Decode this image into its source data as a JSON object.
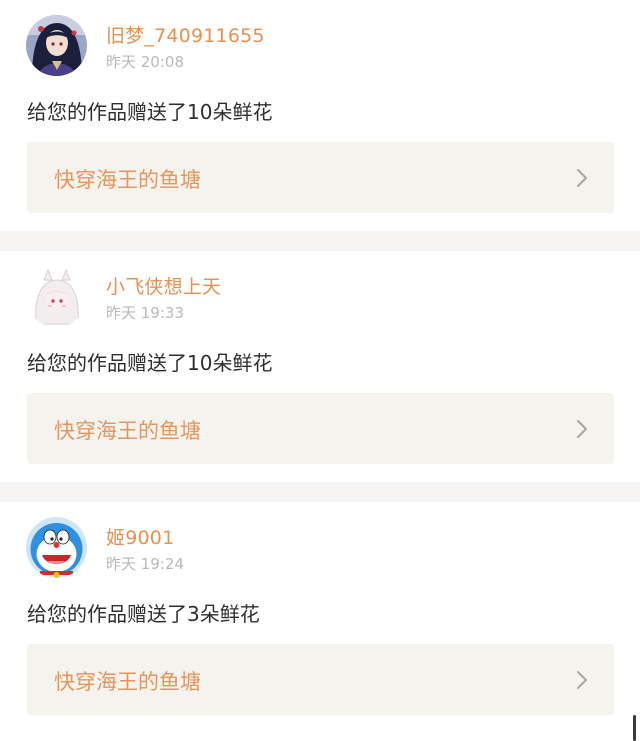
{
  "notifications": [
    {
      "user": "旧梦_740911655",
      "time": "昨天 20:08",
      "message": "给您的作品赠送了10朵鲜花",
      "book": "快穿海王的鱼塘",
      "avatar": "avatar-dark-haired-anime-character"
    },
    {
      "user": "小飞侠想上天",
      "time": "昨天 19:33",
      "message": "给您的作品赠送了10朵鲜花",
      "book": "快穿海王的鱼塘",
      "avatar": "avatar-white-haired-anime-girl"
    },
    {
      "user": "姬9001",
      "time": "昨天 19:24",
      "message": "给您的作品赠送了3朵鲜花",
      "book": "快穿海王的鱼塘",
      "avatar": "avatar-doraemon"
    }
  ],
  "colors": {
    "username": "#e69150",
    "time": "#b9b9b9",
    "message": "#2f2f2f",
    "book_title": "#e6965c",
    "book_bg": "#f4f3ee",
    "separator": "#f6f5f4"
  },
  "icons": {
    "chevron": "chevron-right-icon"
  }
}
